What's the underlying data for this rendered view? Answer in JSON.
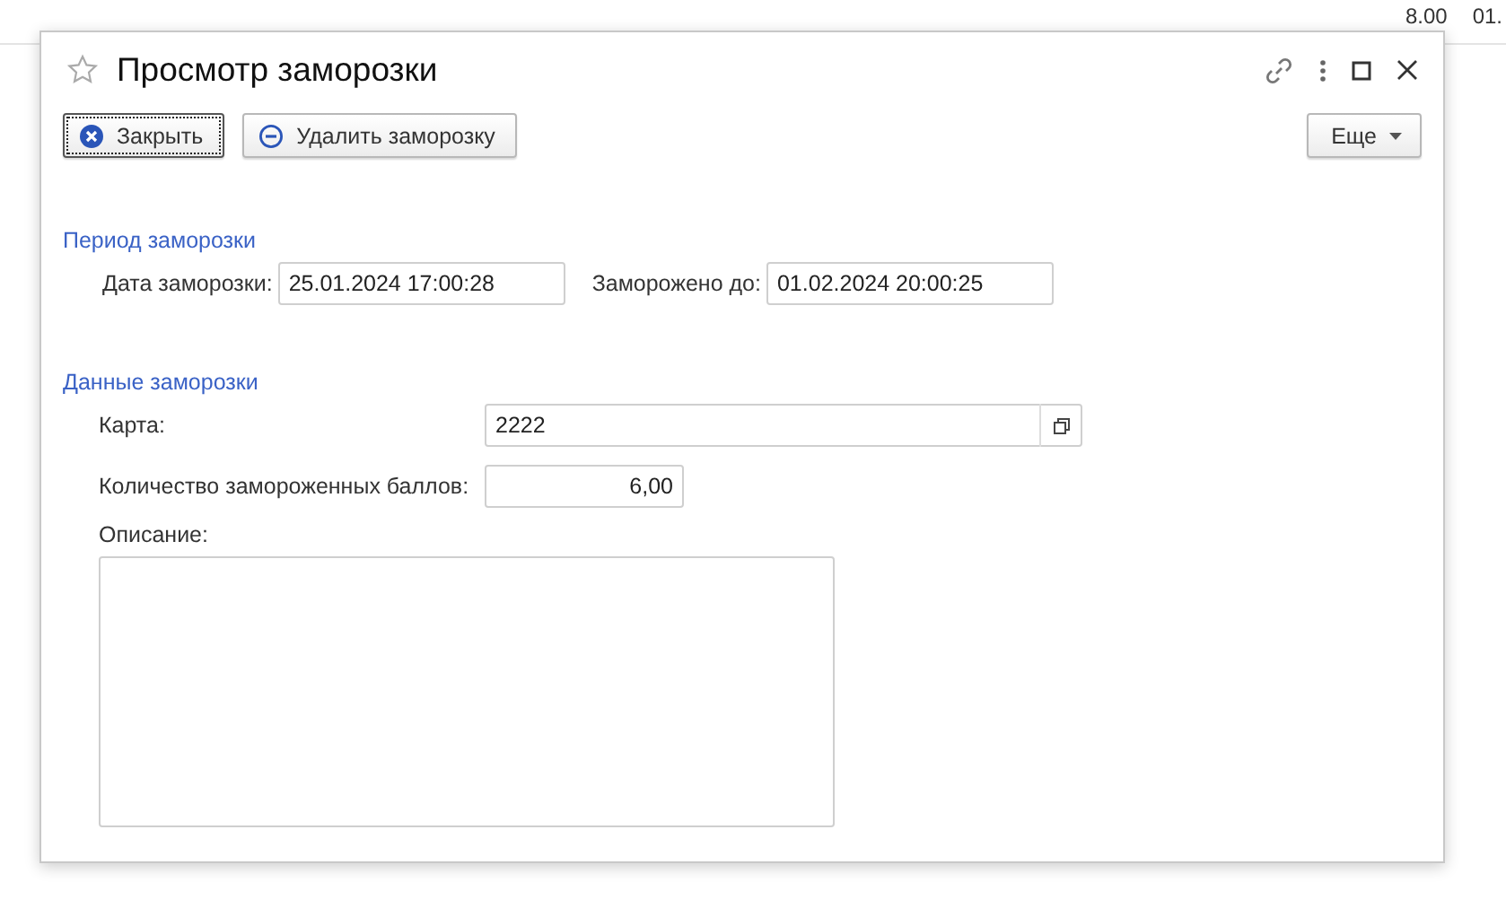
{
  "background": {
    "cells": [
      "8.00",
      "01."
    ]
  },
  "window": {
    "title": "Просмотр заморозки",
    "favorite": false
  },
  "toolbar": {
    "buttons": [
      {
        "kind": "close",
        "label": "Закрыть",
        "focused": true
      },
      {
        "kind": "delete",
        "label": "Удалить заморозку",
        "focused": false
      }
    ],
    "more": {
      "label": "Еще"
    }
  },
  "sections": [
    {
      "title": "Период заморозки",
      "fields": [
        {
          "kind": "inline",
          "label": "Дата заморозки:",
          "value": "25.01.2024 17:00:28"
        },
        {
          "kind": "inline",
          "label": "Заморожено до:",
          "value": "01.02.2024 20:00:25"
        }
      ]
    },
    {
      "title": "Данные заморозки",
      "fields": [
        {
          "kind": "link",
          "label": "Карта:",
          "value": "2222"
        },
        {
          "kind": "number",
          "label": "Количество замороженных баллов:",
          "value": "6,00"
        },
        {
          "kind": "memo",
          "label": "Описание:"
        }
      ]
    }
  ]
}
